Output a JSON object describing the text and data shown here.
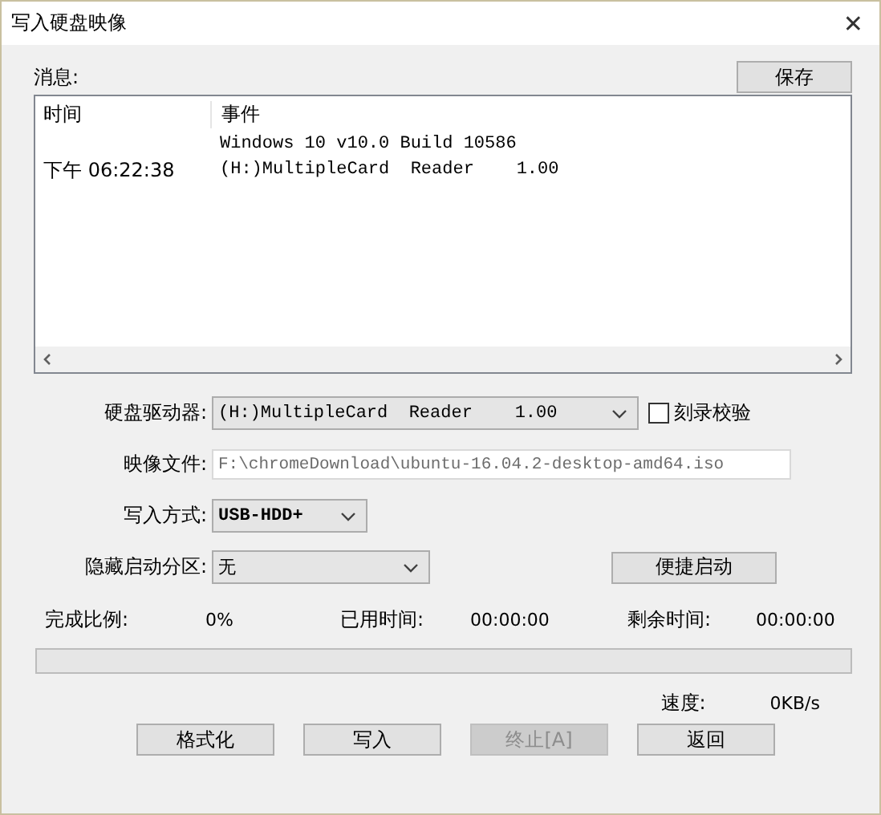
{
  "window": {
    "title": "写入硬盘映像",
    "close": "✕"
  },
  "messages": {
    "label": "消息:",
    "save_button": "保存",
    "columns": [
      "时间",
      "事件"
    ],
    "rows": [
      {
        "event": "Windows 10 v10.0 Build 10586"
      },
      {
        "time": "下午 06:22:38",
        "event": "(H:)MultipleCard  Reader    1.00"
      }
    ]
  },
  "drive": {
    "label": "硬盘驱动器:",
    "value": "(H:)MultipleCard  Reader    1.00"
  },
  "verify": {
    "label": "刻录校验",
    "checked": false
  },
  "image_file": {
    "label": "映像文件:",
    "value": "F:\\chromeDownload\\ubuntu-16.04.2-desktop-amd64.iso"
  },
  "write_mode": {
    "label": "写入方式:",
    "value": "USB-HDD+"
  },
  "hidden_partition": {
    "label": "隐藏启动分区:",
    "value": "无"
  },
  "quick_boot_button": "便捷启动",
  "stats": [
    {
      "label": "完成比例:",
      "value": "0%"
    },
    {
      "label": "已用时间:",
      "value": "00:00:00"
    },
    {
      "label": "剩余时间:",
      "value": "00:00:00"
    }
  ],
  "progress": {
    "level": 0
  },
  "speed": {
    "label": "速度:",
    "value": "0KB/s"
  },
  "buttons": [
    {
      "label": "格式化",
      "disabled": false
    },
    {
      "label": "写入",
      "disabled": false
    },
    {
      "label": "终止[A]",
      "disabled": true
    },
    {
      "label": "返回",
      "disabled": false
    }
  ]
}
